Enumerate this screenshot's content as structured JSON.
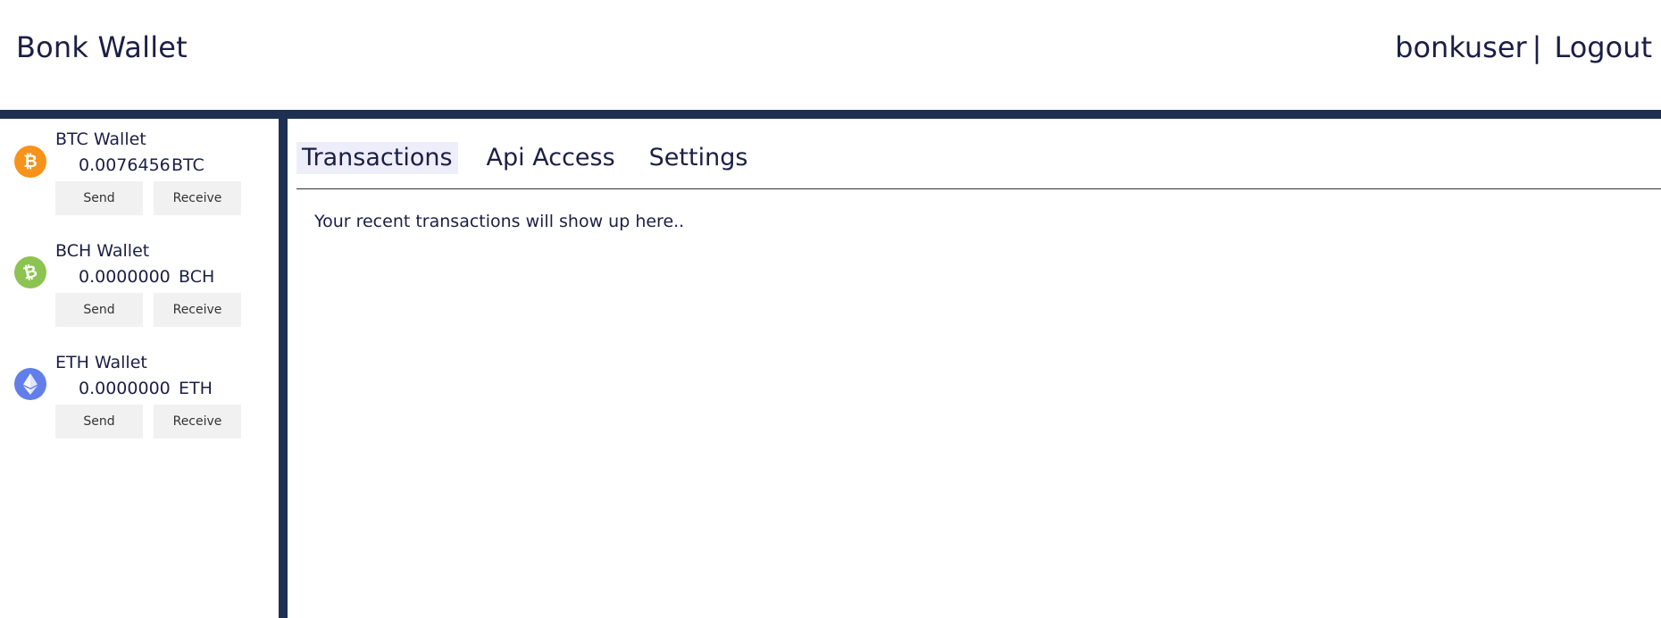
{
  "header": {
    "app_title": "Bonk Wallet",
    "username": "bonkuser",
    "separator": "|",
    "logout_label": "Logout"
  },
  "colors": {
    "navy_bar": "#1e2f52",
    "btc": "#f7931a",
    "bch": "#8dc351",
    "eth": "#627eea",
    "tab_active_bg": "#eeeefb"
  },
  "wallets": [
    {
      "name": "BTC Wallet",
      "amount": "0.0076456",
      "unit": "BTC",
      "icon": "bitcoin-icon",
      "send_label": "Send",
      "receive_label": "Receive"
    },
    {
      "name": "BCH Wallet",
      "amount": "0.0000000",
      "unit": "BCH",
      "icon": "bitcoin-cash-icon",
      "send_label": "Send",
      "receive_label": "Receive"
    },
    {
      "name": "ETH Wallet",
      "amount": "0.0000000",
      "unit": "ETH",
      "icon": "ethereum-icon",
      "send_label": "Send",
      "receive_label": "Receive"
    }
  ],
  "tabs": [
    {
      "label": "Transactions",
      "active": true
    },
    {
      "label": "Api Access",
      "active": false
    },
    {
      "label": "Settings",
      "active": false
    }
  ],
  "main": {
    "empty_message": "Your recent transactions will show up here.."
  }
}
